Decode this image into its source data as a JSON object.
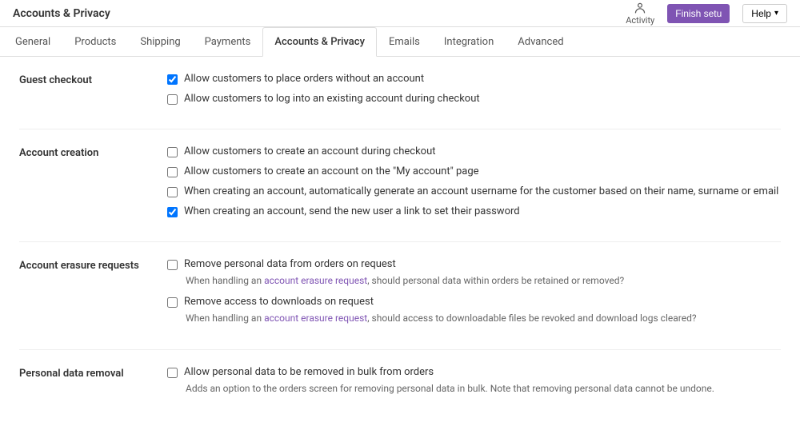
{
  "topbar": {
    "title": "Accounts & Privacy",
    "activity_label": "Activity",
    "finish_setup_label": "Finish setu",
    "help_label": "Help"
  },
  "tabs": [
    {
      "id": "general",
      "label": "General"
    },
    {
      "id": "products",
      "label": "Products"
    },
    {
      "id": "shipping",
      "label": "Shipping"
    },
    {
      "id": "payments",
      "label": "Payments"
    },
    {
      "id": "accounts-privacy",
      "label": "Accounts & Privacy",
      "active": true
    },
    {
      "id": "emails",
      "label": "Emails"
    },
    {
      "id": "integration",
      "label": "Integration"
    },
    {
      "id": "advanced",
      "label": "Advanced"
    }
  ],
  "sections": {
    "guest_checkout": {
      "label": "Guest checkout",
      "options": [
        {
          "id": "place-orders",
          "label": "Allow customers to place orders without an account",
          "checked": true
        },
        {
          "id": "log-into",
          "label": "Allow customers to log into an existing account during checkout",
          "checked": false
        }
      ]
    },
    "account_creation": {
      "label": "Account creation",
      "options": [
        {
          "id": "create-during-checkout",
          "label": "Allow customers to create an account during checkout",
          "checked": false
        },
        {
          "id": "create-my-account",
          "label": "Allow customers to create an account on the \"My account\" page",
          "checked": false
        },
        {
          "id": "auto-generate-username",
          "label": "When creating an account, automatically generate an account username for the customer based on their name, surname or email",
          "checked": false
        },
        {
          "id": "send-link",
          "label": "When creating an account, send the new user a link to set their password",
          "checked": true
        }
      ]
    },
    "account_erasure": {
      "label": "Account erasure requests",
      "remove_orders": {
        "label": "Remove personal data from orders on request",
        "checked": false,
        "sub_text_prefix": "When handling an ",
        "sub_text_link": "account erasure request",
        "sub_text_suffix": ", should personal data within orders be retained or removed?"
      },
      "remove_downloads": {
        "label": "Remove access to downloads on request",
        "checked": false,
        "sub_text_prefix": "When handling an ",
        "sub_text_link": "account erasure request",
        "sub_text_suffix": ", should access to downloadable files be revoked and download logs cleared?"
      }
    },
    "personal_data_removal": {
      "label": "Personal data removal",
      "option": {
        "id": "bulk-remove",
        "label": "Allow personal data to be removed in bulk from orders",
        "checked": false
      },
      "sub_text": "Adds an option to the orders screen for removing personal data in bulk. Note that removing personal data cannot be undone."
    }
  }
}
